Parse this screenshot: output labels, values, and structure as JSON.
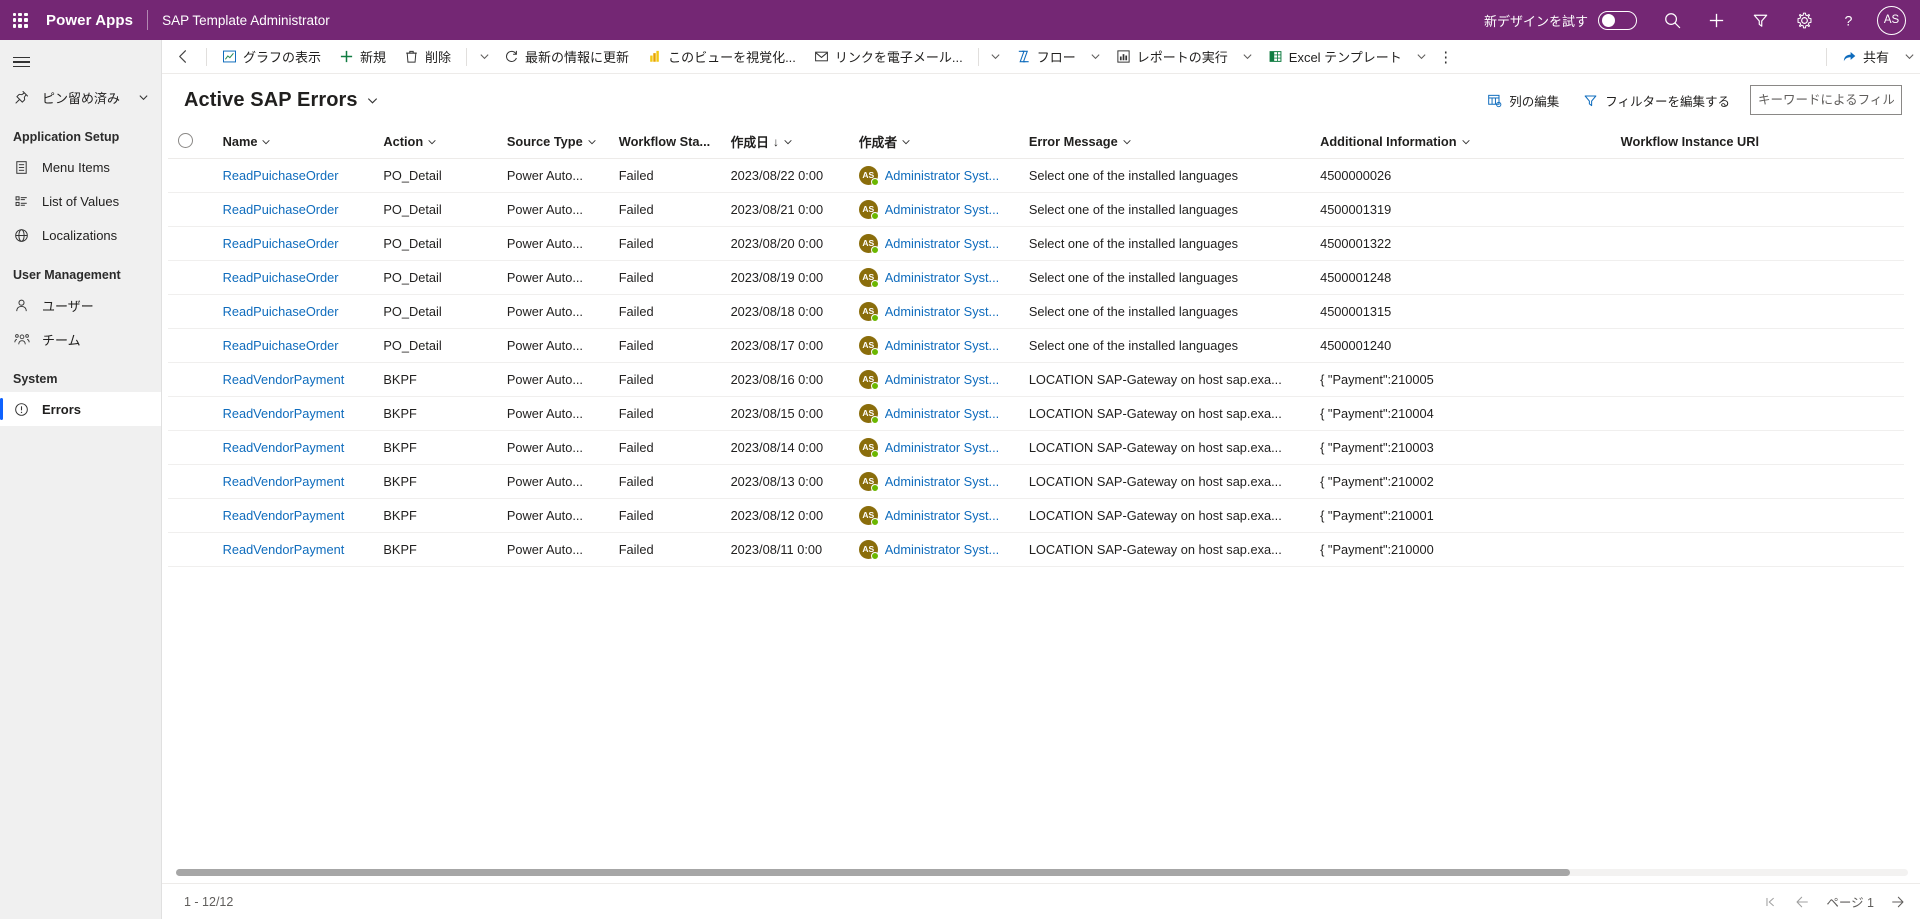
{
  "appbar": {
    "waffle_title": "app-launcher",
    "brand": "Power Apps",
    "app_name": "SAP Template Administrator",
    "new_design_label": "新デザインを試す",
    "search_title": "検索",
    "add_title": "新規作成",
    "filter_title": "フィルター",
    "settings_title": "設定",
    "help_title": "ヘルプ",
    "avatar_initials": "AS"
  },
  "sidebar": {
    "pinned_label": "ピン留め済み",
    "groups": [
      {
        "title": "Application Setup",
        "items": [
          {
            "label": "Menu Items",
            "icon": "document-icon",
            "selected": false
          },
          {
            "label": "List of Values",
            "icon": "list-icon",
            "selected": false
          },
          {
            "label": "Localizations",
            "icon": "globe-icon",
            "selected": false
          }
        ]
      },
      {
        "title": "User Management",
        "items": [
          {
            "label": "ユーザー",
            "icon": "person-icon",
            "selected": false
          },
          {
            "label": "チーム",
            "icon": "people-icon",
            "selected": false
          }
        ]
      },
      {
        "title": "System",
        "items": [
          {
            "label": "Errors",
            "icon": "error-circle-icon",
            "selected": true
          }
        ]
      }
    ]
  },
  "commandbar": {
    "back_title": "戻る",
    "items": [
      {
        "label": "グラフの表示",
        "icon": "chart-icon",
        "caret": false
      },
      {
        "label": "新規",
        "icon": "plus-icon",
        "caret": false
      },
      {
        "label": "削除",
        "icon": "trash-icon",
        "caret": true,
        "divider_before_caret": true
      },
      {
        "label": "最新の情報に更新",
        "icon": "refresh-icon",
        "caret": false
      },
      {
        "label": "このビューを視覚化...",
        "icon": "visualize-icon",
        "caret": false
      },
      {
        "label": "リンクを電子メール...",
        "icon": "email-link-icon",
        "caret": true,
        "divider_before_caret": true
      },
      {
        "label": "フロー",
        "icon": "flow-icon",
        "caret": true
      },
      {
        "label": "レポートの実行",
        "icon": "report-icon",
        "caret": true
      },
      {
        "label": "Excel テンプレート",
        "icon": "excel-icon",
        "caret": true
      }
    ],
    "more_label": "⋮",
    "share_label": "共有",
    "share_icon": "share-icon"
  },
  "view": {
    "title": "Active SAP Errors",
    "edit_columns_label": "列の編集",
    "edit_filters_label": "フィルターを編集する",
    "filter_placeholder": "キーワードによるフィルター",
    "filter_value": ""
  },
  "grid": {
    "columns": [
      {
        "label": "Name",
        "sorted": false
      },
      {
        "label": "Action",
        "sorted": false
      },
      {
        "label": "Source Type",
        "sorted": false
      },
      {
        "label": "Workflow Sta...",
        "sorted": false
      },
      {
        "label": "作成日",
        "sorted": true,
        "sort_dir": "↓"
      },
      {
        "label": "作成者",
        "sorted": false
      },
      {
        "label": "Error Message",
        "sorted": false
      },
      {
        "label": "Additional Information",
        "sorted": false
      },
      {
        "label": "Workflow Instance URl",
        "sorted": false,
        "no_caret": true
      }
    ],
    "owner_initials": "AS",
    "rows": [
      {
        "name": "ReadPuichaseOrder",
        "action": "PO_Detail",
        "source_type": "Power Auto...",
        "workflow_status": "Failed",
        "created_on": "2023/08/22 0:00",
        "created_by": "Administrator Syst...",
        "error_message": "Select one of the installed languages",
        "additional_information": "4500000026",
        "workflow_instance_url": ""
      },
      {
        "name": "ReadPuichaseOrder",
        "action": "PO_Detail",
        "source_type": "Power Auto...",
        "workflow_status": "Failed",
        "created_on": "2023/08/21 0:00",
        "created_by": "Administrator Syst...",
        "error_message": "Select one of the installed languages",
        "additional_information": "4500001319",
        "workflow_instance_url": ""
      },
      {
        "name": "ReadPuichaseOrder",
        "action": "PO_Detail",
        "source_type": "Power Auto...",
        "workflow_status": "Failed",
        "created_on": "2023/08/20 0:00",
        "created_by": "Administrator Syst...",
        "error_message": "Select one of the installed languages",
        "additional_information": "4500001322",
        "workflow_instance_url": ""
      },
      {
        "name": "ReadPuichaseOrder",
        "action": "PO_Detail",
        "source_type": "Power Auto...",
        "workflow_status": "Failed",
        "created_on": "2023/08/19 0:00",
        "created_by": "Administrator Syst...",
        "error_message": "Select one of the installed languages",
        "additional_information": "4500001248",
        "workflow_instance_url": ""
      },
      {
        "name": "ReadPuichaseOrder",
        "action": "PO_Detail",
        "source_type": "Power Auto...",
        "workflow_status": "Failed",
        "created_on": "2023/08/18 0:00",
        "created_by": "Administrator Syst...",
        "error_message": "Select one of the installed languages",
        "additional_information": "4500001315",
        "workflow_instance_url": ""
      },
      {
        "name": "ReadPuichaseOrder",
        "action": "PO_Detail",
        "source_type": "Power Auto...",
        "workflow_status": "Failed",
        "created_on": "2023/08/17 0:00",
        "created_by": "Administrator Syst...",
        "error_message": "Select one of the installed languages",
        "additional_information": "4500001240",
        "workflow_instance_url": ""
      },
      {
        "name": "ReadVendorPayment",
        "action": "BKPF",
        "source_type": "Power Auto...",
        "workflow_status": "Failed",
        "created_on": "2023/08/16 0:00",
        "created_by": "Administrator Syst...",
        "error_message": "LOCATION SAP-Gateway on host sap.exa...",
        "additional_information": "{ \"Payment\":210005",
        "workflow_instance_url": ""
      },
      {
        "name": "ReadVendorPayment",
        "action": "BKPF",
        "source_type": "Power Auto...",
        "workflow_status": "Failed",
        "created_on": "2023/08/15 0:00",
        "created_by": "Administrator Syst...",
        "error_message": "LOCATION SAP-Gateway on host sap.exa...",
        "additional_information": "{ \"Payment\":210004",
        "workflow_instance_url": ""
      },
      {
        "name": "ReadVendorPayment",
        "action": "BKPF",
        "source_type": "Power Auto...",
        "workflow_status": "Failed",
        "created_on": "2023/08/14 0:00",
        "created_by": "Administrator Syst...",
        "error_message": "LOCATION SAP-Gateway on host sap.exa...",
        "additional_information": "{ \"Payment\":210003",
        "workflow_instance_url": ""
      },
      {
        "name": "ReadVendorPayment",
        "action": "BKPF",
        "source_type": "Power Auto...",
        "workflow_status": "Failed",
        "created_on": "2023/08/13 0:00",
        "created_by": "Administrator Syst...",
        "error_message": "LOCATION SAP-Gateway on host sap.exa...",
        "additional_information": "{ \"Payment\":210002",
        "workflow_instance_url": ""
      },
      {
        "name": "ReadVendorPayment",
        "action": "BKPF",
        "source_type": "Power Auto...",
        "workflow_status": "Failed",
        "created_on": "2023/08/12 0:00",
        "created_by": "Administrator Syst...",
        "error_message": "LOCATION SAP-Gateway on host sap.exa...",
        "additional_information": "{ \"Payment\":210001",
        "workflow_instance_url": ""
      },
      {
        "name": "ReadVendorPayment",
        "action": "BKPF",
        "source_type": "Power Auto...",
        "workflow_status": "Failed",
        "created_on": "2023/08/11 0:00",
        "created_by": "Administrator Syst...",
        "error_message": "LOCATION SAP-Gateway on host sap.exa...",
        "additional_information": "{ \"Payment\":210000",
        "workflow_instance_url": ""
      }
    ]
  },
  "footer": {
    "record_count": "1 - 12/12",
    "page_label": "ページ 1"
  },
  "colors": {
    "brand_purple": "#742774",
    "link_blue": "#0f6cbd",
    "selected_indicator": "#0f62fe",
    "avatar_olive": "#8a6d0b",
    "presence_green": "#6bb700"
  }
}
